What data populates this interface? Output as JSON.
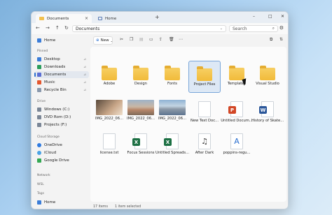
{
  "tabs": [
    {
      "label": "Documents"
    },
    {
      "label": "Home"
    }
  ],
  "window_controls": {
    "minimize": "–",
    "maximize": "□",
    "close": "✕"
  },
  "nav": {
    "back": "←",
    "forward": "→",
    "up": "↑",
    "refresh": "↻"
  },
  "address": {
    "path": "Documents"
  },
  "search": {
    "placeholder": "Search"
  },
  "toolbar": {
    "new_label": "New"
  },
  "sidebar": {
    "home": "Home",
    "pinned_header": "Pinned",
    "pinned": [
      {
        "label": "Desktop",
        "icon": "desktop-icon",
        "color": "#3b7dd8"
      },
      {
        "label": "Downloads",
        "icon": "download-icon",
        "color": "#2a9d5c"
      },
      {
        "label": "Documents",
        "icon": "document-icon",
        "color": "#5b6fd4"
      },
      {
        "label": "Music",
        "icon": "music-icon",
        "color": "#e4572e"
      },
      {
        "label": "Recycle Bin",
        "icon": "recycle-bin-icon",
        "color": "#8a99ad"
      }
    ],
    "drives_header": "Drive",
    "drives": [
      {
        "label": "Windows (C:)"
      },
      {
        "label": "DVD Rom (D:)"
      },
      {
        "label": "Projects (F:)"
      }
    ],
    "cloud_header": "Cloud Storage",
    "cloud": [
      {
        "label": "OneDrive",
        "color": "#2f7be0"
      },
      {
        "label": "iCloud",
        "color": "#4aa3e6"
      },
      {
        "label": "Google Drive",
        "color": "#34a853"
      }
    ],
    "network_header": "Network",
    "wsl_header": "WSL",
    "tags_header": "Tags",
    "bottom_home": "Home"
  },
  "files": [
    {
      "label": "Adobe",
      "kind": "folder"
    },
    {
      "label": "Design",
      "kind": "folder"
    },
    {
      "label": "Fonts",
      "kind": "folder"
    },
    {
      "label": "Project Files",
      "kind": "folder",
      "selected": true
    },
    {
      "label": "Templates",
      "kind": "folder"
    },
    {
      "label": "Visual Studio",
      "kind": "folder"
    },
    {
      "label": "IMG_2022_06...",
      "kind": "image",
      "colors": [
        "#5a4a3c",
        "#c9a789"
      ]
    },
    {
      "label": "IMG_2022_06...",
      "kind": "image",
      "colors": [
        "#9eb3c8",
        "#b8876a"
      ]
    },
    {
      "label": "IMG_2022_06...",
      "kind": "image",
      "colors": [
        "#8fb3d4",
        "#5e7590"
      ]
    },
    {
      "label": "New Text Doc...",
      "kind": "text"
    },
    {
      "label": "Untitled Docum...",
      "kind": "ppt",
      "letter": "P",
      "color": "#d24726"
    },
    {
      "label": "History of Skate...",
      "kind": "word",
      "letter": "W",
      "color": "#2b579a"
    },
    {
      "label": "license.txt",
      "kind": "text"
    },
    {
      "label": "Focus Sessions",
      "kind": "excel",
      "letter": "X",
      "color": "#1d7044"
    },
    {
      "label": "Untitled Spreads...",
      "kind": "excel",
      "letter": "X",
      "color": "#1d7044"
    },
    {
      "label": "After Dark",
      "kind": "music"
    },
    {
      "label": "poppins-regu...",
      "kind": "font"
    }
  ],
  "status": {
    "count": "17 items",
    "selected": "1 item selected"
  }
}
